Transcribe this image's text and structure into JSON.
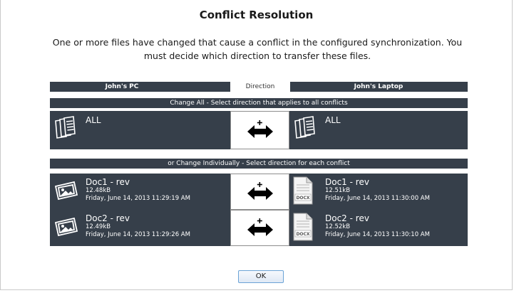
{
  "dialog": {
    "title": "Conflict Resolution",
    "message": "One or more files have changed that cause a conflict in the configured synchronization.  You must decide which direction to transfer these files."
  },
  "header": {
    "left": "John's PC",
    "middle": "Direction",
    "right": "John's Laptop"
  },
  "change_all": {
    "section_label": "Change All - Select direction that applies to all conflicts",
    "left_label": "ALL",
    "right_label": "ALL",
    "left_icon": "multiple-documents-icon",
    "right_icon": "multiple-documents-icon",
    "direction_icon": "bidirectional-arrow-icon"
  },
  "individual": {
    "section_label": "or Change Individually - Select direction for each conflict",
    "rows": [
      {
        "left": {
          "name": "Doc1 - rev",
          "size": "12.48kB",
          "date": "Friday, June 14, 2013 11:29:19 AM"
        },
        "right": {
          "name": "Doc1 - rev",
          "size": "12.51kB",
          "date": "Friday, June 14, 2013 11:30:00 AM"
        }
      },
      {
        "left": {
          "name": "Doc2 - rev",
          "size": "12.49kB",
          "date": "Friday, June 14, 2013 11:29:26 AM"
        },
        "right": {
          "name": "Doc2 - rev",
          "size": "12.52kB",
          "date": "Friday, June 14, 2013 11:30:10 AM"
        }
      }
    ],
    "left_icon": "photo-document-icon",
    "right_icon": "docx-file-icon",
    "file_badge": "DOCX"
  },
  "footer": {
    "ok_label": "OK"
  },
  "colors": {
    "panel": "#363f4a",
    "text": "#ffffff",
    "ok_border": "#6ba3d6"
  }
}
